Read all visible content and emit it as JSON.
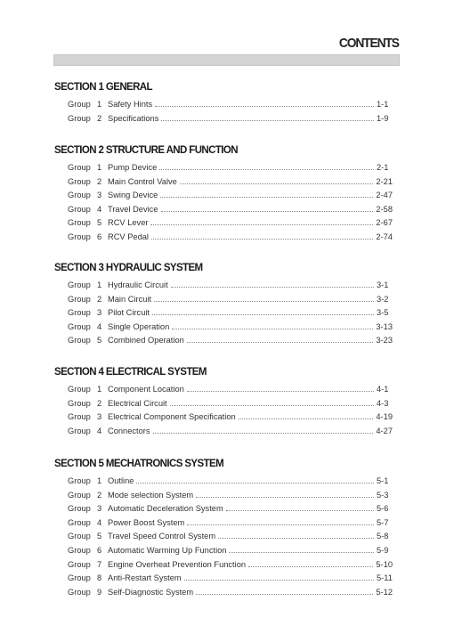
{
  "title": "CONTENTS",
  "group_word": "Group",
  "sections": [
    {
      "title": "SECTION 1  GENERAL",
      "groups": [
        {
          "num": "1",
          "label": "Safety Hints",
          "page": "1-1"
        },
        {
          "num": "2",
          "label": "Specifications",
          "page": "1-9"
        }
      ]
    },
    {
      "title": "SECTION 2  STRUCTURE AND FUNCTION",
      "groups": [
        {
          "num": "1",
          "label": "Pump Device",
          "page": "2-1"
        },
        {
          "num": "2",
          "label": "Main Control Valve",
          "page": "2-21"
        },
        {
          "num": "3",
          "label": "Swing Device",
          "page": "2-47"
        },
        {
          "num": "4",
          "label": "Travel Device",
          "page": "2-58"
        },
        {
          "num": "5",
          "label": "RCV Lever",
          "page": "2-67"
        },
        {
          "num": "6",
          "label": "RCV Pedal",
          "page": "2-74"
        }
      ]
    },
    {
      "title": "SECTION 3  HYDRAULIC SYSTEM",
      "groups": [
        {
          "num": "1",
          "label": "Hydraulic Circuit",
          "page": "3-1"
        },
        {
          "num": "2",
          "label": "Main Circuit",
          "page": "3-2"
        },
        {
          "num": "3",
          "label": "Pilot Circuit",
          "page": "3-5"
        },
        {
          "num": "4",
          "label": "Single Operation",
          "page": "3-13"
        },
        {
          "num": "5",
          "label": "Combined Operation",
          "page": "3-23"
        }
      ]
    },
    {
      "title": "SECTION 4  ELECTRICAL SYSTEM",
      "groups": [
        {
          "num": "1",
          "label": "Component Location",
          "page": "4-1"
        },
        {
          "num": "2",
          "label": "Electrical Circuit",
          "page": "4-3"
        },
        {
          "num": "3",
          "label": "Electrical Component Specification",
          "page": "4-19"
        },
        {
          "num": "4",
          "label": "Connectors",
          "page": "4-27"
        }
      ]
    },
    {
      "title": "SECTION 5  MECHATRONICS SYSTEM",
      "groups": [
        {
          "num": "1",
          "label": "Outline",
          "page": "5-1"
        },
        {
          "num": "2",
          "label": "Mode selection System",
          "page": "5-3"
        },
        {
          "num": "3",
          "label": "Automatic Deceleration System",
          "page": "5-6"
        },
        {
          "num": "4",
          "label": "Power Boost System",
          "page": "5-7"
        },
        {
          "num": "5",
          "label": "Travel Speed Control System",
          "page": "5-8"
        },
        {
          "num": "6",
          "label": "Automatic Warming Up Function",
          "page": "5-9"
        },
        {
          "num": "7",
          "label": "Engine Overheat Prevention Function",
          "page": "5-10"
        },
        {
          "num": "8",
          "label": "Anti-Restart System",
          "page": "5-11"
        },
        {
          "num": "9",
          "label": "Self-Diagnostic System",
          "page": "5-12"
        }
      ]
    }
  ]
}
